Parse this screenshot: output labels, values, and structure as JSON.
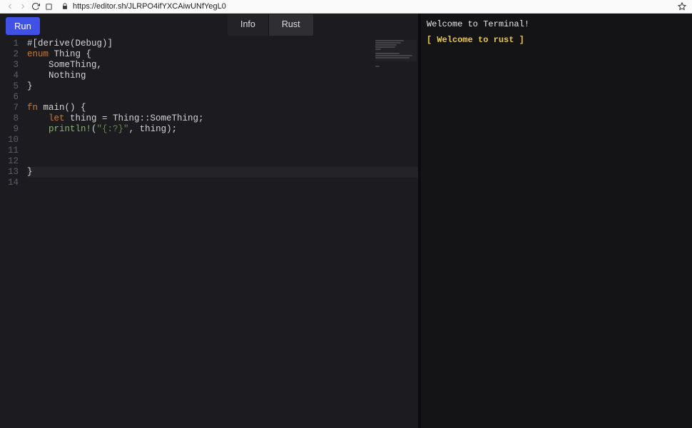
{
  "browser": {
    "url": "https://editor.sh/JLRPO4ifYXCAiwUNfYegL0"
  },
  "toolbar": {
    "run_label": "Run"
  },
  "tabs": [
    {
      "label": "Info",
      "active": false
    },
    {
      "label": "Rust",
      "active": true
    }
  ],
  "code_lines": [
    {
      "n": 1,
      "html": "#[derive(Debug)]"
    },
    {
      "n": 2,
      "html": "<span class='c-kw'>enum</span> Thing {"
    },
    {
      "n": 3,
      "html": "    SomeThing,"
    },
    {
      "n": 4,
      "html": "    Nothing"
    },
    {
      "n": 5,
      "html": "}"
    },
    {
      "n": 6,
      "html": ""
    },
    {
      "n": 7,
      "html": "<span class='c-kw'>fn</span> main() {"
    },
    {
      "n": 8,
      "html": "    <span class='c-kw'>let</span> thing = Thing::SomeThing;"
    },
    {
      "n": 9,
      "html": "    <span class='c-mac'>println!</span>(<span class='c-str'>\"{:?}\"</span>, thing);"
    },
    {
      "n": 10,
      "html": ""
    },
    {
      "n": 11,
      "html": ""
    },
    {
      "n": 12,
      "html": ""
    },
    {
      "n": 13,
      "html": "}",
      "current": true
    },
    {
      "n": 14,
      "html": ""
    }
  ],
  "minimap_widths": [
    40,
    36,
    30,
    28,
    8,
    0,
    34,
    52,
    48,
    0,
    0,
    0,
    6,
    0
  ],
  "terminal": {
    "line1": "Welcome to Terminal!",
    "line2": "[ Welcome to rust ]"
  }
}
